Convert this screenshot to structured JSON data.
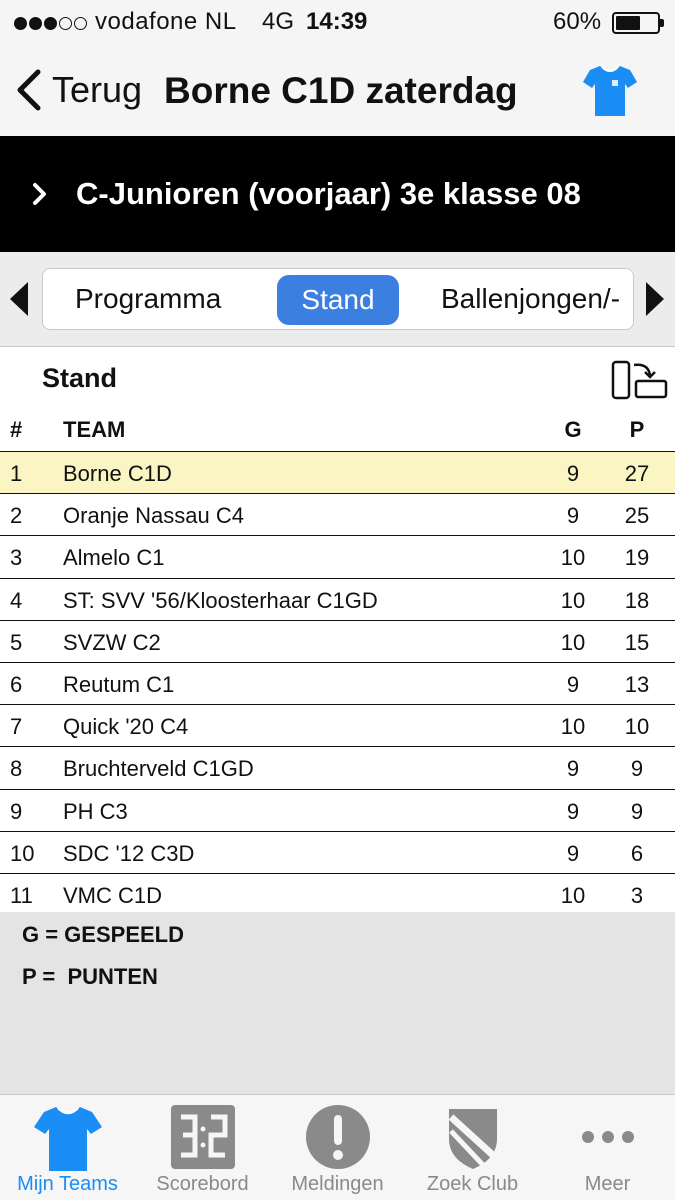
{
  "status_bar": {
    "carrier": "vodafone NL",
    "network": "4G",
    "time": "14:39",
    "battery": "60%",
    "battery_level": 0.6
  },
  "nav": {
    "back_label": "Terug",
    "title": "Borne C1D zaterdag",
    "shirt_icon": "shirt-icon",
    "shirt_color": "#1a8ef5"
  },
  "competition": {
    "title": "C-Junioren (voorjaar) 3e klasse 08"
  },
  "tabs": [
    {
      "label": "Programma",
      "selected": false
    },
    {
      "label": "Stand",
      "selected": true
    },
    {
      "label": "Ballenjongen/-"
    }
  ],
  "standings": {
    "title": "Stand",
    "headers": {
      "rank": "#",
      "team": "TEAM",
      "played": "G",
      "points": "P"
    },
    "rows": [
      {
        "rank": "1",
        "team": "Borne C1D",
        "played": "9",
        "points": "27",
        "highlight": true
      },
      {
        "rank": "2",
        "team": "Oranje Nassau C4",
        "played": "9",
        "points": "25"
      },
      {
        "rank": "3",
        "team": "Almelo C1",
        "played": "10",
        "points": "19"
      },
      {
        "rank": "4",
        "team": "ST: SVV '56/Kloosterhaar C1GD",
        "played": "10",
        "points": "18"
      },
      {
        "rank": "5",
        "team": "SVZW C2",
        "played": "10",
        "points": "15"
      },
      {
        "rank": "6",
        "team": "Reutum C1",
        "played": "9",
        "points": "13"
      },
      {
        "rank": "7",
        "team": "Quick '20 C4",
        "played": "10",
        "points": "10"
      },
      {
        "rank": "8",
        "team": "Bruchterveld C1GD",
        "played": "9",
        "points": "9"
      },
      {
        "rank": "9",
        "team": "PH C3",
        "played": "9",
        "points": "9"
      },
      {
        "rank": "10",
        "team": "SDC '12 C3D",
        "played": "9",
        "points": "6"
      },
      {
        "rank": "11",
        "team": "VMC C1D",
        "played": "10",
        "points": "3"
      }
    ]
  },
  "legend": {
    "played": "G = GESPEELD",
    "points": "P =  PUNTEN"
  },
  "tab_bar": {
    "items": [
      {
        "label": "Mijn Teams",
        "icon": "shirt-icon",
        "active": true
      },
      {
        "label": "Scorebord",
        "icon": "scoreboard-icon"
      },
      {
        "label": "Meldingen",
        "icon": "exclamation-icon"
      },
      {
        "label": "Zoek Club",
        "icon": "shield-icon"
      },
      {
        "label": "Meer",
        "icon": "more-icon"
      }
    ]
  },
  "colors": {
    "accent": "#3b7fe0",
    "highlight_row": "#fbf5c3",
    "tab_active": "#1a8ef5",
    "tab_inactive": "#8a8a8a"
  }
}
